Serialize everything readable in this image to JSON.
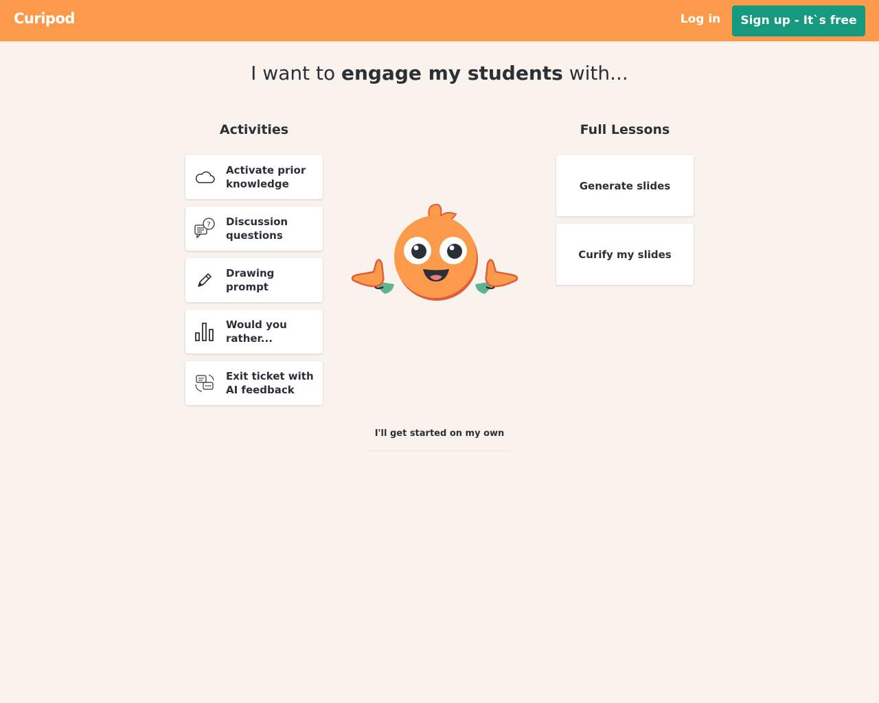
{
  "header": {
    "logo": "Curipod",
    "login_label": "Log in",
    "signup_label": "Sign up - It`s free",
    "brand_color": "#fb9a4b",
    "signup_color": "#169a7f"
  },
  "main": {
    "heading_prefix": "I want to ",
    "heading_bold": "engage my students",
    "heading_suffix": " with...",
    "activities": {
      "title": "Activities",
      "items": [
        {
          "label": "Activate prior knowledge",
          "icon": "cloud-icon"
        },
        {
          "label": "Discussion questions",
          "icon": "discussion-icon"
        },
        {
          "label": "Drawing prompt",
          "icon": "pencil-icon"
        },
        {
          "label": "Would you rather...",
          "icon": "bar-chart-icon"
        },
        {
          "label": "Exit ticket with AI feedback",
          "icon": "feedback-icon"
        }
      ]
    },
    "lessons": {
      "title": "Full Lessons",
      "items": [
        {
          "label": "Generate slides"
        },
        {
          "label": "Curify my slides"
        }
      ]
    },
    "own_label": "I'll get started on my own"
  }
}
